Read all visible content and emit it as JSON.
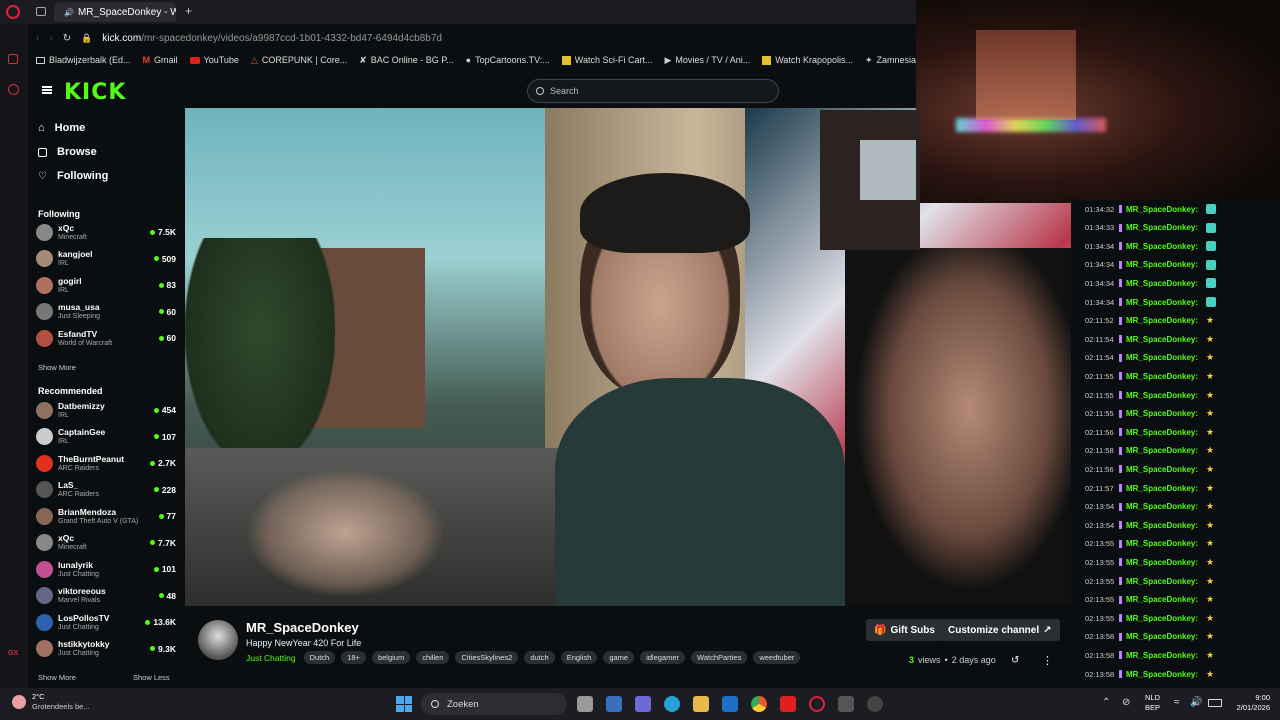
{
  "browser": {
    "tab_title": "MR_SpaceDonkey - Wa",
    "url_host": "kick.com",
    "url_path": "/mr-spacedonkey/videos/a9987ccd-1b01-4332-bd47-6494d4cb8b7d",
    "bookmarks": [
      {
        "icon": "folder-icon",
        "label": "Bladwijzerbalk (Ed..."
      },
      {
        "icon": "gmail-icon",
        "label": "Gmail"
      },
      {
        "icon": "youtube-icon",
        "label": "YouTube"
      },
      {
        "icon": "corepunk-icon",
        "label": "COREPUNK | Core..."
      },
      {
        "icon": "bac-icon",
        "label": "BAC Online - BG P..."
      },
      {
        "icon": "topcartoons-icon",
        "label": "TopCartoons.TV:..."
      },
      {
        "icon": "scifi-icon",
        "label": "Watch Sci-Fi Cart..."
      },
      {
        "icon": "play-icon",
        "label": "Movies / TV / Ani..."
      },
      {
        "icon": "krapopolis-icon",
        "label": "Watch Krapopolis..."
      },
      {
        "icon": "zamnesia-icon",
        "label": "Zamnesia |"
      }
    ]
  },
  "header": {
    "logo": "KICK",
    "search_placeholder": "Search"
  },
  "nav": [
    {
      "icon": "home-icon",
      "label": "Home"
    },
    {
      "icon": "browse-icon",
      "label": "Browse"
    },
    {
      "icon": "heart-icon",
      "label": "Following"
    }
  ],
  "sidebar": {
    "following_title": "Following",
    "following": [
      {
        "name": "xQc",
        "game": "Minecraft",
        "viewers": "7.5K",
        "color": "#888888"
      },
      {
        "name": "kangjoel",
        "game": "IRL",
        "viewers": "509",
        "color": "#a58a78"
      },
      {
        "name": "gogirl",
        "game": "IRL",
        "viewers": "83",
        "color": "#b07060"
      },
      {
        "name": "musa_usa",
        "game": "Just Sleeping",
        "viewers": "60",
        "color": "#777777"
      },
      {
        "name": "EsfandTV",
        "game": "World of Warcraft",
        "viewers": "60",
        "color": "#b05040"
      }
    ],
    "show_more": "Show More",
    "recommended_title": "Recommended",
    "recommended": [
      {
        "name": "Datbemizzy",
        "game": "IRL",
        "viewers": "454",
        "color": "#907060"
      },
      {
        "name": "CaptainGee",
        "game": "IRL",
        "viewers": "107",
        "color": "#cccccc"
      },
      {
        "name": "TheBurntPeanut",
        "game": "ARC Raiders",
        "viewers": "2.7K",
        "color": "#e03020"
      },
      {
        "name": "LaS_",
        "game": "ARC Raiders",
        "viewers": "228",
        "color": "#555555"
      },
      {
        "name": "BrianMendoza",
        "game": "Grand Theft Auto V (GTA)",
        "viewers": "77",
        "color": "#886655"
      },
      {
        "name": "xQc",
        "game": "Minecraft",
        "viewers": "7.7K",
        "color": "#888888"
      },
      {
        "name": "lunalyrik",
        "game": "Just Chatting",
        "viewers": "101",
        "color": "#c05090"
      },
      {
        "name": "viktoreeous",
        "game": "Marvel Rivals",
        "viewers": "48",
        "color": "#666688"
      },
      {
        "name": "LosPollosTV",
        "game": "Just Chatting",
        "viewers": "13.6K",
        "color": "#3060b0"
      },
      {
        "name": "hstikkytokky",
        "game": "Just Chatting",
        "viewers": "9.3K",
        "color": "#a07060"
      }
    ],
    "show_more_2": "Show More",
    "show_less": "Show Less"
  },
  "channel": {
    "name": "MR_SpaceDonkey",
    "title": "Happy NewYear 420 For Life",
    "category": "Just Chatting",
    "tags": [
      "Dutch",
      "18+",
      "belgium",
      "chillen",
      "CitiesSkylines2",
      "dutch",
      "English",
      "game",
      "idlegamer",
      "WatchParties",
      "weedtuber"
    ],
    "views_count": "3",
    "views_label": "views",
    "age": "2 days ago",
    "gift_subs": "Gift Subs",
    "customize": "Customize channel"
  },
  "chat": [
    {
      "time": "01:34:32",
      "user": "MR_SpaceDonkey:",
      "emote": "robot"
    },
    {
      "time": "01:34:33",
      "user": "MR_SpaceDonkey:",
      "emote": "robot"
    },
    {
      "time": "01:34:34",
      "user": "MR_SpaceDonkey:",
      "emote": "robot"
    },
    {
      "time": "01:34:34",
      "user": "MR_SpaceDonkey:",
      "emote": "robot"
    },
    {
      "time": "01:34:34",
      "user": "MR_SpaceDonkey:",
      "emote": "robot"
    },
    {
      "time": "01:34:34",
      "user": "MR_SpaceDonkey:",
      "emote": "robot"
    },
    {
      "time": "02:11:52",
      "user": "MR_SpaceDonkey:",
      "emote": "star"
    },
    {
      "time": "02:11:54",
      "user": "MR_SpaceDonkey:",
      "emote": "star"
    },
    {
      "time": "02:11:54",
      "user": "MR_SpaceDonkey:",
      "emote": "star"
    },
    {
      "time": "02:11:55",
      "user": "MR_SpaceDonkey:",
      "emote": "star"
    },
    {
      "time": "02:11:55",
      "user": "MR_SpaceDonkey:",
      "emote": "star"
    },
    {
      "time": "02:11:55",
      "user": "MR_SpaceDonkey:",
      "emote": "star"
    },
    {
      "time": "02:11:56",
      "user": "MR_SpaceDonkey:",
      "emote": "star"
    },
    {
      "time": "02:11:58",
      "user": "MR_SpaceDonkey:",
      "emote": "star"
    },
    {
      "time": "02:11:56",
      "user": "MR_SpaceDonkey:",
      "emote": "star"
    },
    {
      "time": "02:11:57",
      "user": "MR_SpaceDonkey:",
      "emote": "star"
    },
    {
      "time": "02:13:54",
      "user": "MR_SpaceDonkey:",
      "emote": "star"
    },
    {
      "time": "02:13:54",
      "user": "MR_SpaceDonkey:",
      "emote": "star"
    },
    {
      "time": "02:13:55",
      "user": "MR_SpaceDonkey:",
      "emote": "star"
    },
    {
      "time": "02:13:55",
      "user": "MR_SpaceDonkey:",
      "emote": "star"
    },
    {
      "time": "02:13:55",
      "user": "MR_SpaceDonkey:",
      "emote": "star"
    },
    {
      "time": "02:13:55",
      "user": "MR_SpaceDonkey:",
      "emote": "star"
    },
    {
      "time": "02:13:55",
      "user": "MR_SpaceDonkey:",
      "emote": "star"
    },
    {
      "time": "02:13:58",
      "user": "MR_SpaceDonkey:",
      "emote": "star"
    },
    {
      "time": "02:13:58",
      "user": "MR_SpaceDonkey:",
      "emote": "star"
    },
    {
      "time": "02:13:58",
      "user": "MR_SpaceDonkey:",
      "emote": "star"
    }
  ],
  "taskbar": {
    "weather_temp": "2°C",
    "weather_desc": "Grotendeels be...",
    "search": "Zoeken",
    "lang_1": "NLD",
    "lang_2": "BEP",
    "time": "9:00",
    "date": "2/01/2026"
  },
  "colors": {
    "accent": "#53fc18",
    "bg": "#0b0e10"
  }
}
